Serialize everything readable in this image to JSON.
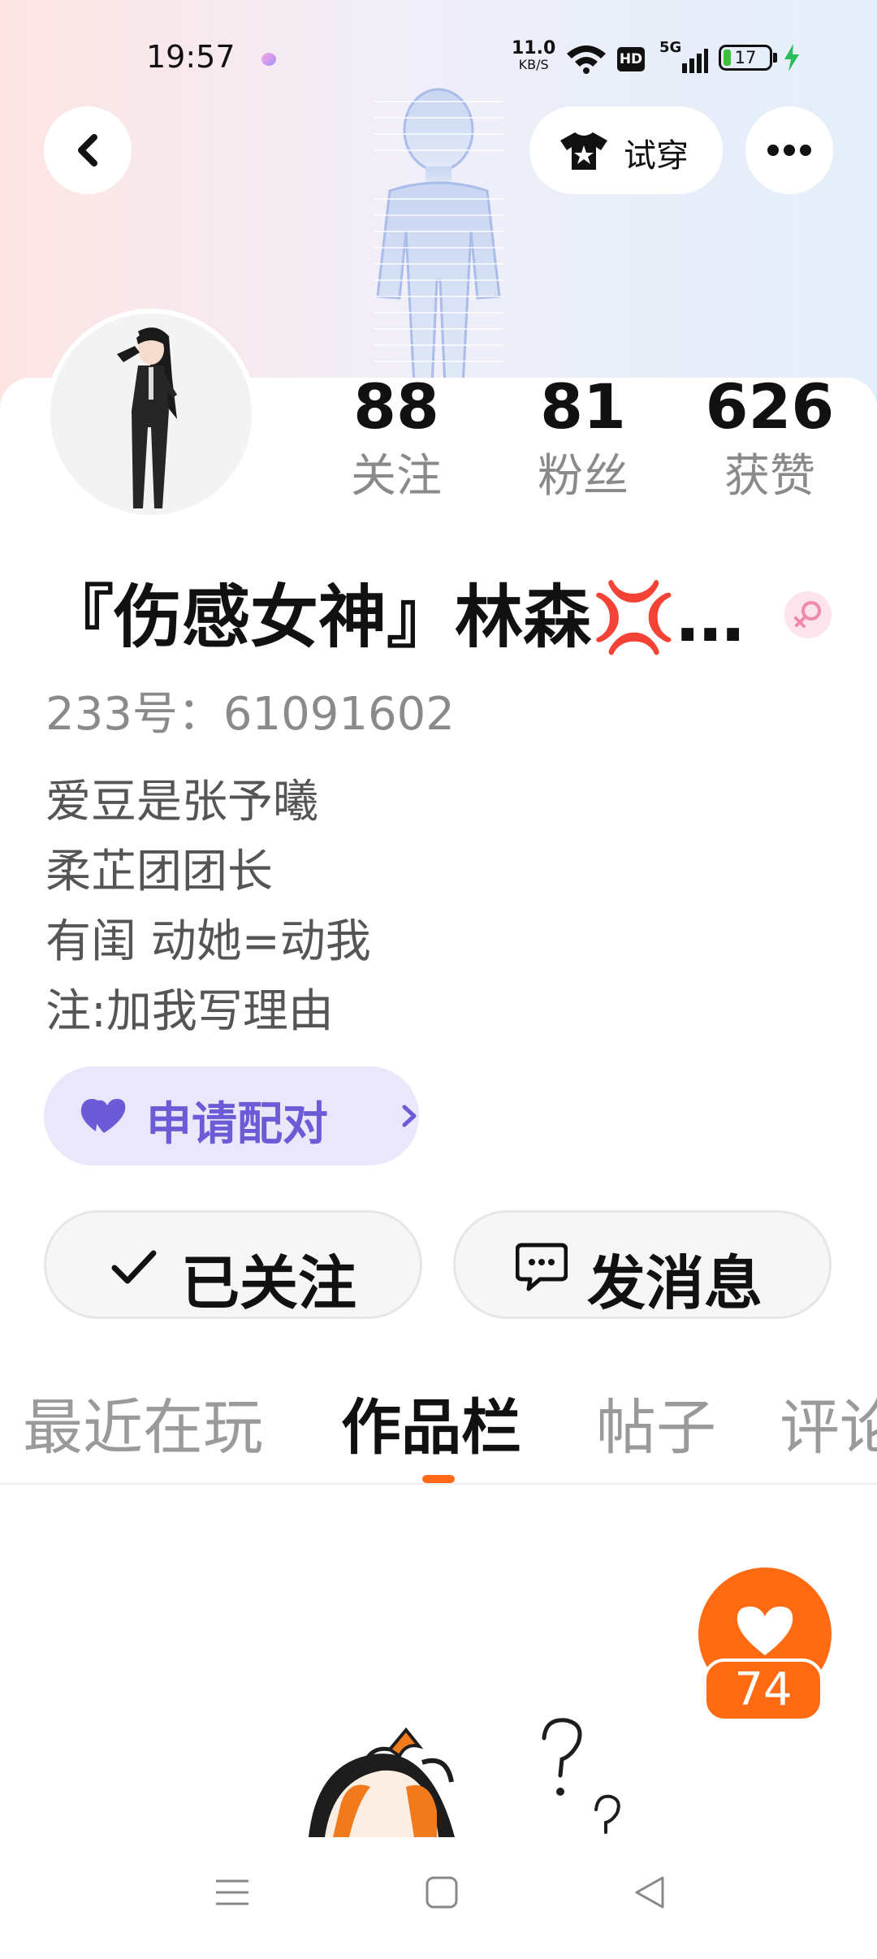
{
  "status_bar": {
    "time": "19:57",
    "net_speed_value": "11.0",
    "net_speed_unit": "KB/S",
    "hd_label": "HD",
    "network_label": "5G",
    "battery_level": "17",
    "battery_fraction": 0.17
  },
  "header": {
    "try_on_label": "试穿"
  },
  "stats": {
    "following_count": "88",
    "following_label": "关注",
    "followers_count": "81",
    "followers_label": "粉丝",
    "likes_count": "626",
    "likes_label": "获赞"
  },
  "profile": {
    "nickname": "『伤感女神』林森💢…",
    "user_id": "233号：61091602",
    "bio_lines": [
      "爱豆是张予曦",
      "柔芷团团长",
      "有闺  动她=动我",
      "注:加我写理由"
    ],
    "gender": "female"
  },
  "actions": {
    "pair_label": "申请配对",
    "follow_label": "已关注",
    "message_label": "发消息"
  },
  "tabs": [
    {
      "label": "最近在玩",
      "active": false
    },
    {
      "label": "作品栏",
      "active": true
    },
    {
      "label": "帖子",
      "active": false
    },
    {
      "label": "评论",
      "active": false
    }
  ],
  "work": {
    "like_count": "74"
  },
  "colors": {
    "accent_orange": "#ff6a12",
    "pair_purple": "#6b5bd6",
    "pair_bg": "#ebe7fb",
    "gender_pink": "#f08aa8"
  }
}
